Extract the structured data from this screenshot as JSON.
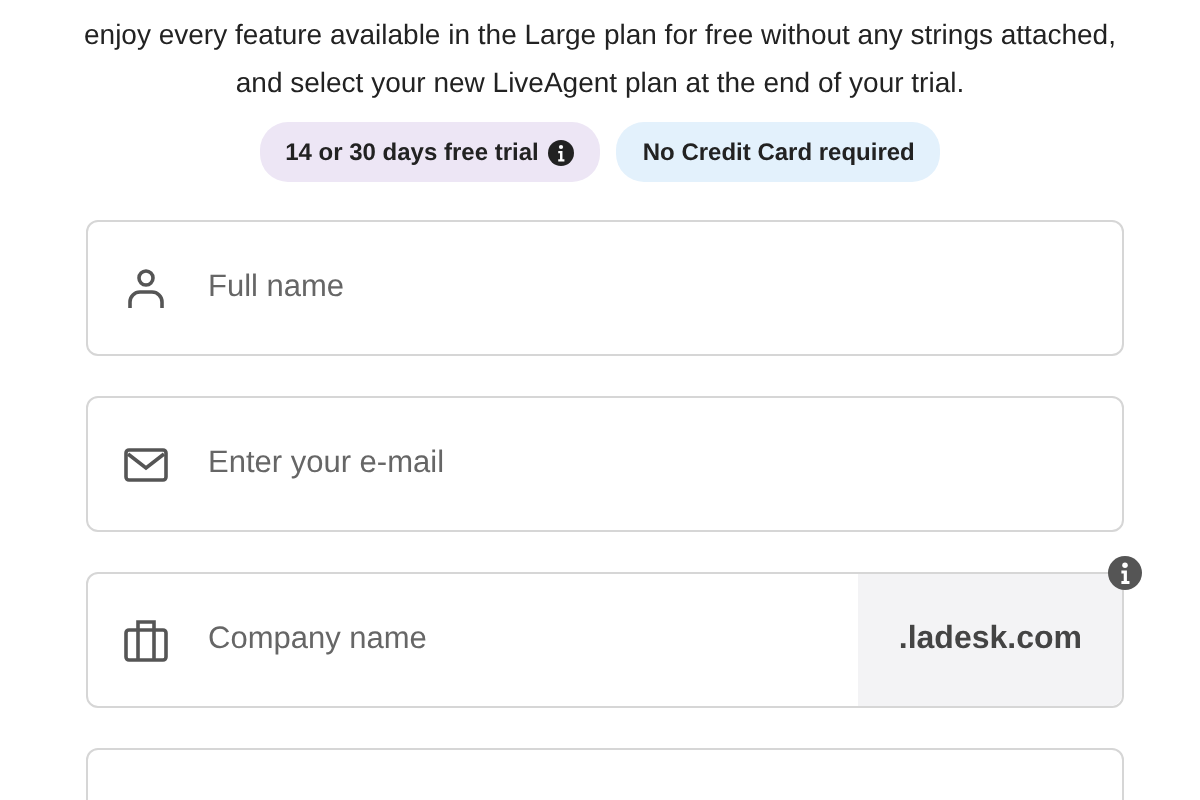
{
  "intro": "enjoy every feature available in the Large plan for free without any strings attached, and select your new LiveAgent plan at the end of your trial.",
  "badges": [
    {
      "label": "14 or 30 days free trial",
      "color": "#ede6f5",
      "info": true
    },
    {
      "label": "No Credit Card required",
      "color": "#e3f1fc",
      "info": false
    }
  ],
  "fields": [
    {
      "kind": "name",
      "placeholder": "Full name"
    },
    {
      "kind": "email",
      "placeholder": "Enter your e-mail"
    },
    {
      "kind": "company",
      "placeholder": "Company name",
      "suffix": ".ladesk.com",
      "info": true
    },
    {
      "kind": "blank"
    }
  ]
}
